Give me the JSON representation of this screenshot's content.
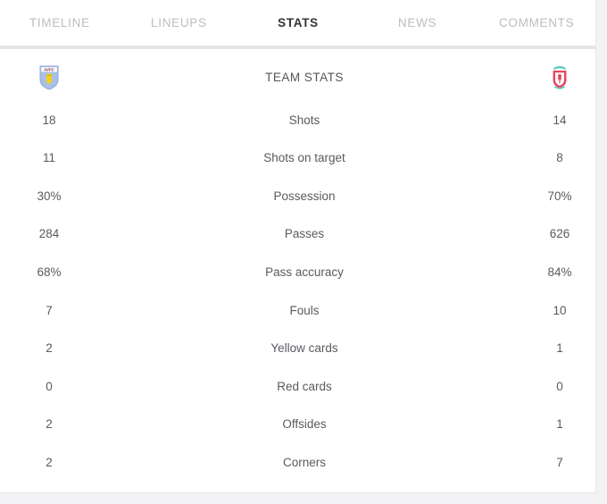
{
  "tabs": [
    {
      "label": "TIMELINE",
      "active": false,
      "name": "tab-timeline"
    },
    {
      "label": "LINEUPS",
      "active": false,
      "name": "tab-lineups"
    },
    {
      "label": "STATS",
      "active": true,
      "name": "tab-stats"
    },
    {
      "label": "NEWS",
      "active": false,
      "name": "tab-news"
    },
    {
      "label": "COMMENTS",
      "active": false,
      "name": "tab-comments"
    }
  ],
  "stats": {
    "header": {
      "title": "TEAM STATS",
      "home_team_badge": "aston-villa-badge",
      "away_team_badge": "liverpool-badge",
      "home_badge_text": "AVFC"
    },
    "rows": [
      {
        "home": "18",
        "label": "Shots",
        "away": "14"
      },
      {
        "home": "11",
        "label": "Shots on target",
        "away": "8"
      },
      {
        "home": "30%",
        "label": "Possession",
        "away": "70%"
      },
      {
        "home": "284",
        "label": "Passes",
        "away": "626"
      },
      {
        "home": "68%",
        "label": "Pass accuracy",
        "away": "84%"
      },
      {
        "home": "7",
        "label": "Fouls",
        "away": "10"
      },
      {
        "home": "2",
        "label": "Yellow cards",
        "away": "1"
      },
      {
        "home": "0",
        "label": "Red cards",
        "away": "0"
      },
      {
        "home": "2",
        "label": "Offsides",
        "away": "1"
      },
      {
        "home": "2",
        "label": "Corners",
        "away": "7"
      }
    ]
  },
  "colors": {
    "page_background": "#f3f3f5",
    "card_background": "#ffffff",
    "active_tab_text": "#333338",
    "inactive_tab_text": "#bdbdc2",
    "value_text": "#5a5a60",
    "divider": "#e4e4e9",
    "villa_shield": "#a8bfe8",
    "villa_lion": "#f5d218",
    "villa_band": "#7c1f3c",
    "liverpool_red": "#e8455f",
    "liverpool_teal": "#5fc6c4"
  }
}
